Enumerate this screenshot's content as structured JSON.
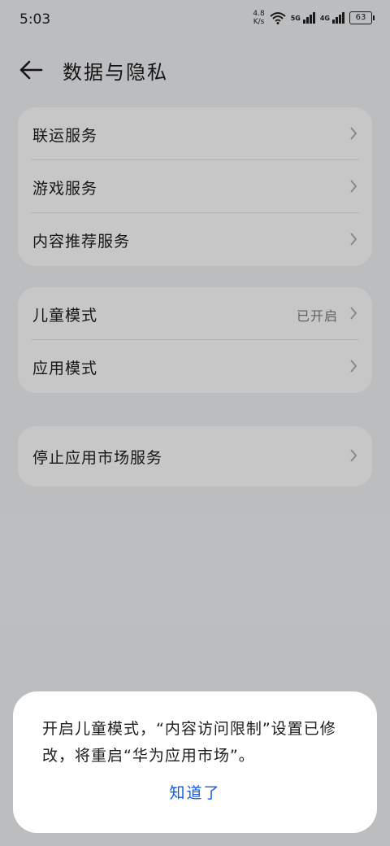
{
  "status_bar": {
    "time": "5:03",
    "speed_value": "4.8",
    "speed_unit": "K/s",
    "net1": "5G",
    "net2": "4G",
    "battery": "63"
  },
  "header": {
    "title": "数据与隐私"
  },
  "cards": [
    {
      "rows": [
        {
          "label": "联运服务"
        },
        {
          "label": "游戏服务"
        },
        {
          "label": "内容推荐服务"
        }
      ]
    },
    {
      "rows": [
        {
          "label": "儿童模式",
          "value": "已开启"
        },
        {
          "label": "应用模式"
        }
      ]
    },
    {
      "rows": [
        {
          "label": "停止应用市场服务"
        }
      ]
    }
  ],
  "dialog": {
    "message": "开启儿童模式，“内容访问限制”设置已修改，将重启“华为应用市场”。",
    "button": "知道了"
  },
  "colors": {
    "accent": "#0a59f7",
    "background": "#f1f3f5",
    "card": "#ffffff"
  }
}
